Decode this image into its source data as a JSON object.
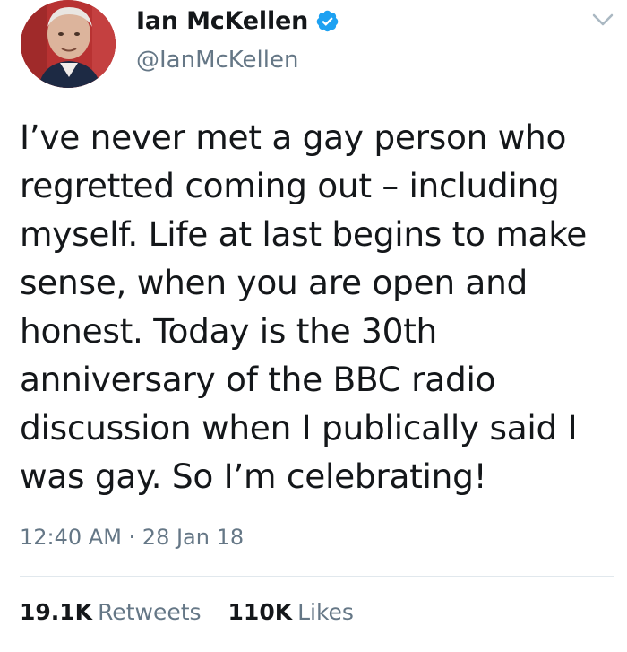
{
  "author": {
    "display_name": "Ian McKellen",
    "handle": "@IanMcKellen",
    "verified": true,
    "avatar_icon": "avatar-photo"
  },
  "tweet": {
    "text": "I’ve never met a gay person who regretted coming out – including myself. Life at last begins to make sense, when you are open and honest. Today is the 30th anniversary of the BBC radio discussion when I publically said I was gay. So I’m celebrating!",
    "timestamp": "12:40 AM · 28 Jan 18"
  },
  "stats": {
    "retweets_count": "19.1K",
    "retweets_label": "Retweets",
    "likes_count": "110K",
    "likes_label": "Likes"
  },
  "colors": {
    "verified_blue": "#1da1f2",
    "secondary_text": "#657786",
    "primary_text": "#14171a"
  },
  "icons": {
    "verified": "verified-badge-icon",
    "menu": "chevron-down-icon"
  }
}
